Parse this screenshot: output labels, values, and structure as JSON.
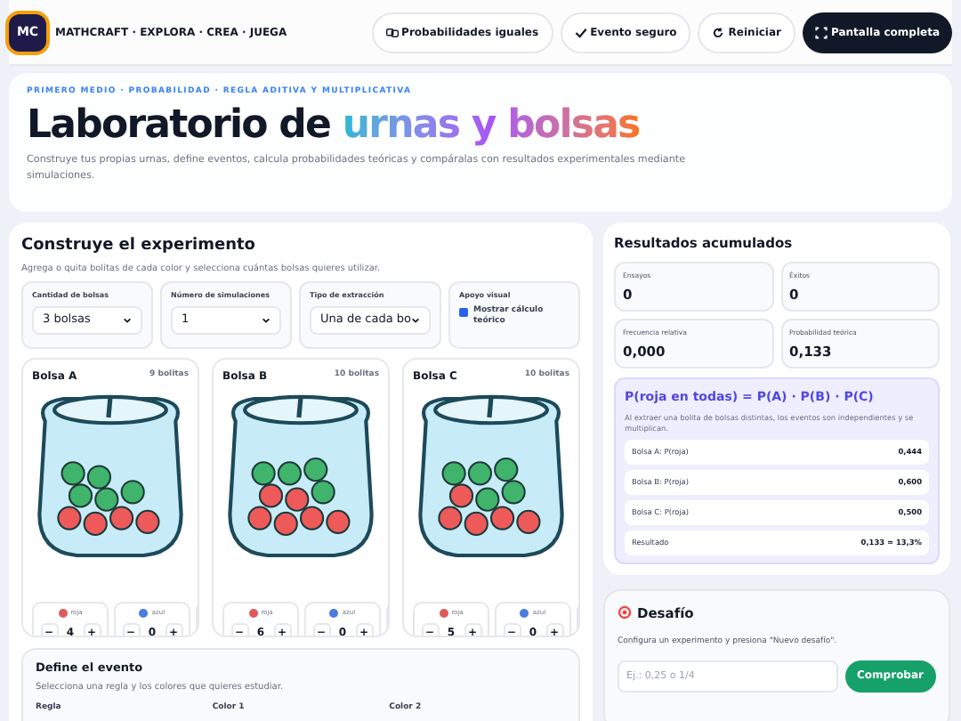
{
  "brand": {
    "logo": "MC",
    "name": "MATHCRAFT · EXPLORA · CREA · JUEGA"
  },
  "toolbar": [
    {
      "label": "Probabilidades iguales",
      "kind": "light"
    },
    {
      "label": "Evento seguro",
      "kind": "light"
    },
    {
      "label": "Reiniciar",
      "kind": "light"
    },
    {
      "label": "Pantalla completa",
      "kind": "dark"
    }
  ],
  "hero": {
    "eyebrow": "PRIMERO MEDIO · PROBABILIDAD · REGLA ADITIVA Y MULTIPLICATIVA",
    "title_plain": "Laboratorio de ",
    "title_gradient": "urnas y bolsas",
    "subtitle": "Construye tus propias urnas, define eventos, calcula probabilidades teóricas y compáralas con resultados experimentales mediante simulaciones."
  },
  "experiment": {
    "title": "Construye el experimento",
    "subtitle": "Agrega o quita bolitas de cada color y selecciona cuántas bolsas quieres utilizar.",
    "controls": [
      {
        "kind": "select",
        "label": "Cantidad de bolsas",
        "value": "3 bolsas"
      },
      {
        "kind": "select",
        "label": "Número de simulaciones",
        "value": "1"
      },
      {
        "kind": "select",
        "label": "Tipo de extracción",
        "value": "Una de cada bo"
      },
      {
        "kind": "checkbox",
        "label": "Apoyo visual",
        "option": "Mostrar cálculo teórico",
        "checked": true
      }
    ],
    "bags": [
      {
        "name": "Bolsa A",
        "count": "9 bolitas",
        "balls": [
          {
            "color": "#3fb46a"
          },
          {
            "color": "#3fb46a"
          },
          {
            "color": "#3fb46a"
          },
          {
            "color": "#3fb46a"
          },
          {
            "color": "#3fb46a"
          },
          {
            "color": "#ee5a5a"
          },
          {
            "color": "#ee5a5a"
          },
          {
            "color": "#ee5a5a"
          },
          {
            "color": "#ee5a5a"
          }
        ],
        "counters": [
          {
            "label": "roja",
            "color": "#e05a5a",
            "minus": "−",
            "value": "4",
            "plus": "+"
          },
          {
            "label": "azul",
            "color": "#4a7be0",
            "minus": "−",
            "value": "0",
            "plus": "+"
          }
        ]
      },
      {
        "name": "Bolsa B",
        "count": "10 bolitas",
        "balls": [
          {
            "color": "#3fb46a"
          },
          {
            "color": "#3fb46a"
          },
          {
            "color": "#3fb46a"
          },
          {
            "color": "#ee5a5a"
          },
          {
            "color": "#ee5a5a"
          },
          {
            "color": "#3fb46a"
          },
          {
            "color": "#ee5a5a"
          },
          {
            "color": "#ee5a5a"
          },
          {
            "color": "#ee5a5a"
          },
          {
            "color": "#ee5a5a"
          }
        ],
        "counters": [
          {
            "label": "roja",
            "color": "#e05a5a",
            "minus": "−",
            "value": "6",
            "plus": "+"
          },
          {
            "label": "azul",
            "color": "#4a7be0",
            "minus": "−",
            "value": "0",
            "plus": "+"
          }
        ]
      },
      {
        "name": "Bolsa C",
        "count": "10 bolitas",
        "balls": [
          {
            "color": "#3fb46a"
          },
          {
            "color": "#3fb46a"
          },
          {
            "color": "#3fb46a"
          },
          {
            "color": "#ee5a5a"
          },
          {
            "color": "#3fb46a"
          },
          {
            "color": "#3fb46a"
          },
          {
            "color": "#ee5a5a"
          },
          {
            "color": "#ee5a5a"
          },
          {
            "color": "#ee5a5a"
          },
          {
            "color": "#ee5a5a"
          }
        ],
        "counters": [
          {
            "label": "roja",
            "color": "#e05a5a",
            "minus": "−",
            "value": "5",
            "plus": "+"
          },
          {
            "label": "azul",
            "color": "#4a7be0",
            "minus": "−",
            "value": "0",
            "plus": "+"
          }
        ]
      }
    ],
    "event": {
      "title": "Define el evento",
      "subtitle": "Selecciona una regla y los colores que quieres estudiar.",
      "fields": [
        "Regla",
        "Color 1",
        "Color 2"
      ]
    }
  },
  "results": {
    "title": "Resultados acumulados",
    "stats": [
      {
        "label": "Ensayos",
        "value": "0"
      },
      {
        "label": "Éxitos",
        "value": "0"
      },
      {
        "label": "Frecuencia relativa",
        "value": "0,000"
      },
      {
        "label": "Probabilidad teórica",
        "value": "0,133"
      }
    ],
    "formula": {
      "title": "P(roja en todas) = P(A) · P(B) · P(C)",
      "note": "Al extraer una bolita de bolsas distintas, los eventos son independientes y se multiplican.",
      "rows": [
        {
          "label": "Bolsa A: P(roja)",
          "value": "0,444"
        },
        {
          "label": "Bolsa B: P(roja)",
          "value": "0,600"
        },
        {
          "label": "Bolsa C: P(roja)",
          "value": "0,500"
        },
        {
          "label": "Resultado",
          "value": "0,133 = 13,3%"
        }
      ]
    }
  },
  "challenge": {
    "title": "Desafío",
    "note": "Configura un experimento y presiona \"Nuevo desafío\".",
    "placeholder": "Ej.: 0,25 o 1/4",
    "button": "Comprobar"
  }
}
